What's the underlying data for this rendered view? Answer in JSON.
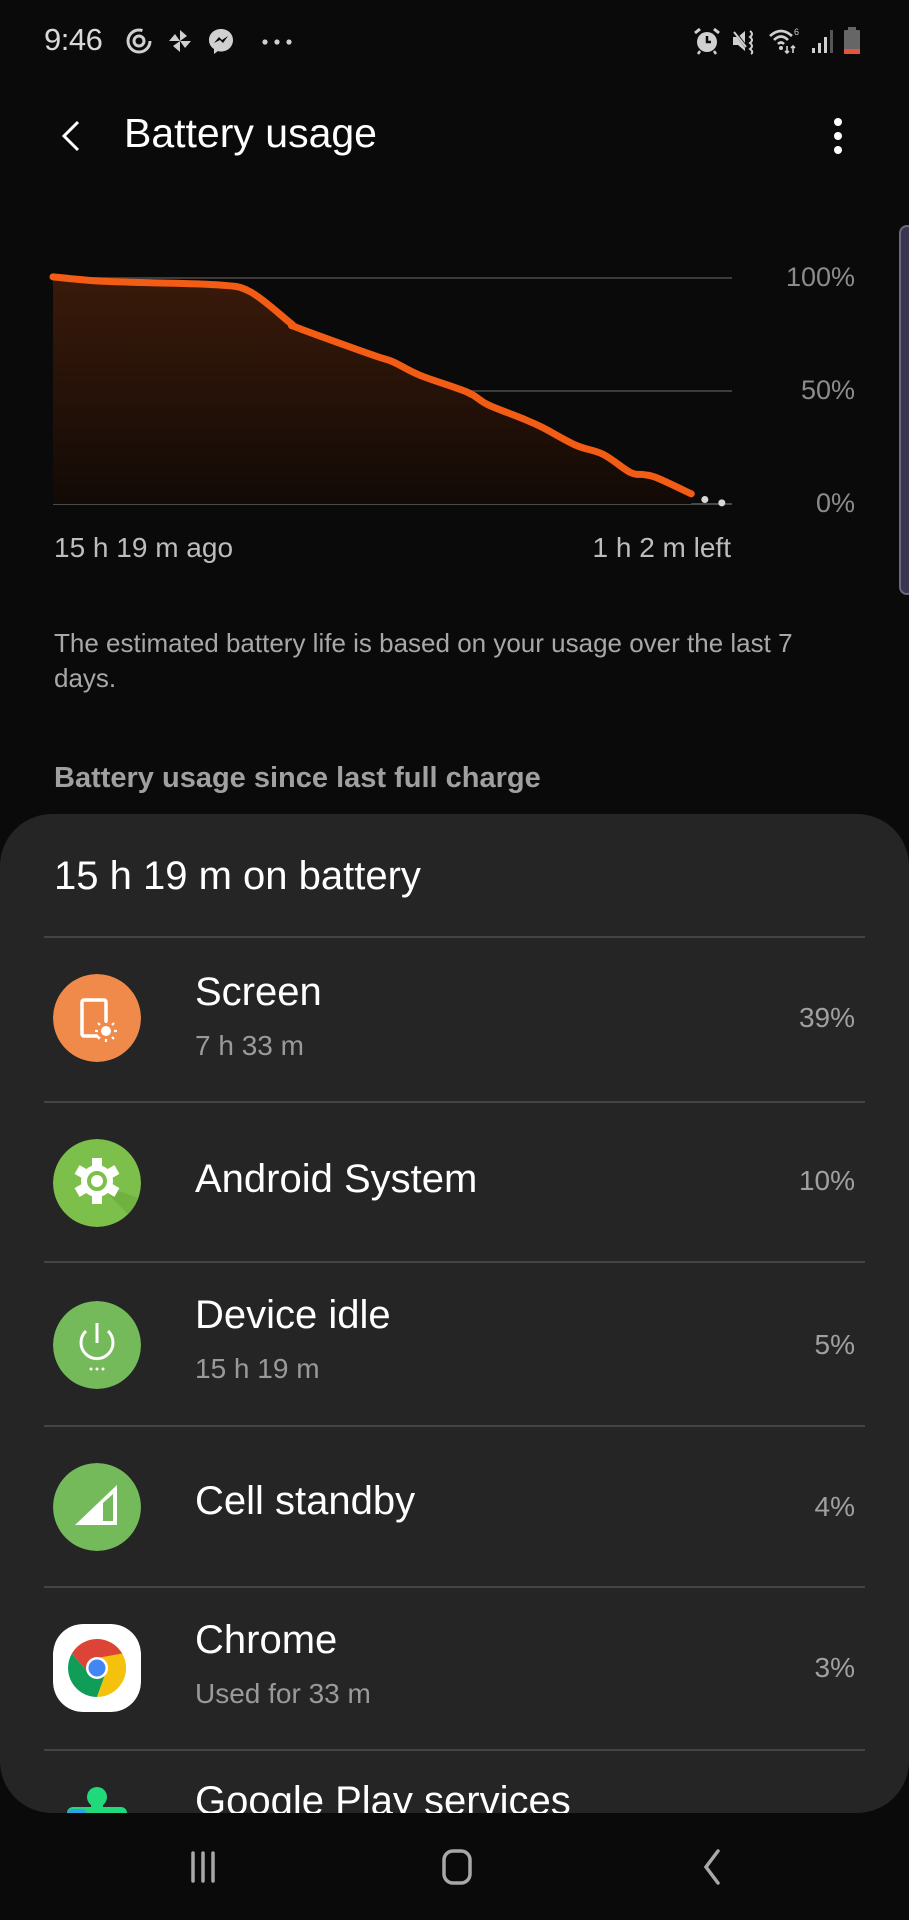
{
  "status_bar": {
    "time": "9:46",
    "left_icons": [
      "sync-icon",
      "pinwheel-app-icon",
      "messenger-icon",
      "more-notifications-icon"
    ],
    "right_icons": [
      "alarm-icon",
      "mute-vibrate-icon",
      "wifi-icon",
      "signal-icon",
      "battery-low-icon"
    ],
    "wifi_badge": "6",
    "battery_color": "#e2563a"
  },
  "app_bar": {
    "title": "Battery usage",
    "back_icon": "back-chevron-icon",
    "more_icon": "more-vertical-icon"
  },
  "chart_data": {
    "type": "area",
    "title": "",
    "xlabel": "",
    "ylabel": "",
    "x_start_label": "15 h 19 m ago",
    "x_end_label": "1 h 2 m left",
    "y_ticks": [
      "100%",
      "50%",
      "0%"
    ],
    "ylim": [
      0,
      100
    ],
    "grid": true,
    "line_color": "#f25c15",
    "series": [
      {
        "name": "Battery level (history)",
        "x": [
          0,
          0.06,
          0.13,
          0.24,
          0.29,
          0.35,
          0.36,
          0.47,
          0.5,
          0.54,
          0.61,
          0.64,
          0.69,
          0.72,
          0.77,
          0.81,
          0.85,
          0.87,
          0.89,
          0.94
        ],
        "values": [
          100.5,
          98.8,
          98,
          97,
          94,
          80,
          78,
          66,
          63,
          57,
          49.5,
          44,
          38,
          34,
          26,
          22,
          14,
          13,
          11.5,
          4.5
        ]
      },
      {
        "name": "Battery level (estimated)",
        "style": "dotted",
        "x": [
          0.96,
          0.985
        ],
        "values": [
          2,
          0.5
        ]
      }
    ]
  },
  "description": "The estimated battery life is based on your usage over the last 7 days.",
  "section_header": "Battery usage since last full charge",
  "usage_card": {
    "title": "15 h 19 m on battery",
    "items": [
      {
        "name": "Screen",
        "sub": "7 h 33 m",
        "percent": "39%",
        "icon": "screen-brightness-icon",
        "icon_color": "#ef8a4b"
      },
      {
        "name": "Android System",
        "sub": "",
        "percent": "10%",
        "icon": "gear-icon",
        "icon_color": "#7cbf4a"
      },
      {
        "name": "Device idle",
        "sub": "15 h 19 m",
        "percent": "5%",
        "icon": "power-icon",
        "icon_color": "#74b95a"
      },
      {
        "name": "Cell standby",
        "sub": "",
        "percent": "4%",
        "icon": "cell-signal-icon",
        "icon_color": "#74b95a"
      },
      {
        "name": "Chrome",
        "sub": "Used for 33 m",
        "percent": "3%",
        "icon": "chrome-icon",
        "icon_color": "#ffffff"
      },
      {
        "name": "Google Play services",
        "sub": "",
        "percent": "",
        "icon": "google-play-services-icon",
        "icon_color": "#1fd97a"
      }
    ]
  },
  "nav_bar": {
    "buttons": [
      "recents-icon",
      "home-icon",
      "back-icon"
    ]
  }
}
